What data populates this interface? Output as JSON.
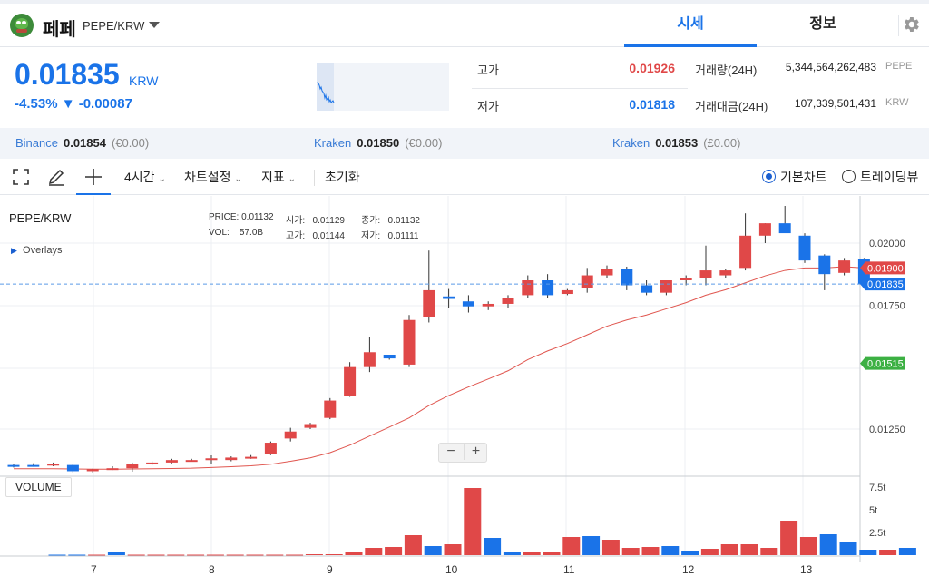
{
  "header": {
    "coin_name": "페페",
    "pair": "PEPE/KRW",
    "tabs": [
      {
        "label": "시세"
      },
      {
        "label": "정보"
      }
    ]
  },
  "summary": {
    "price": "0.01835",
    "price_unit": "KRW",
    "change": "-4.53% ▼ -0.00087",
    "high_label": "고가",
    "high_value": "0.01926",
    "low_label": "저가",
    "low_value": "0.01818",
    "volume_label": "거래량(24H)",
    "volume_value": "5,344,564,262,483",
    "volume_unit": "PEPE",
    "amount_label": "거래대금(24H)",
    "amount_value": "107,339,501,431",
    "amount_unit": "KRW"
  },
  "exchanges": [
    {
      "name": "Binance",
      "price": "0.01854",
      "krw": "(€0.00)"
    },
    {
      "name": "Kraken",
      "price": "0.01850",
      "krw": "(€0.00)"
    },
    {
      "name": "Kraken",
      "price": "0.01853",
      "krw": "(£0.00)"
    }
  ],
  "toolbar": {
    "interval": "4시간",
    "chart_settings": "차트설정",
    "indicators": "지표",
    "reset": "초기화",
    "basic_chart": "기본차트",
    "tradingview": "트레이딩뷰"
  },
  "chart": {
    "pair_title": "PEPE/KRW",
    "overlays": "Overlays",
    "legend": {
      "price_label": "PRICE:",
      "price": "0.01132",
      "open_label": "시가:",
      "open": "0.01129",
      "close_label": "종가:",
      "close": "0.01132",
      "vol_label": "VOL:",
      "vol": "57.0B",
      "high_label": "고가:",
      "high": "0.01144",
      "low_label": "저가:",
      "low": "0.01111"
    },
    "volume_tag": "VOLUME",
    "zoom_out": "−",
    "zoom_in": "+"
  },
  "chart_data": {
    "type": "candlestick",
    "price_axis_ticks": [
      "0.02000",
      "0.01750",
      "0.01250"
    ],
    "price_tags": [
      {
        "value": "0.01900",
        "color": "#e04848"
      },
      {
        "value": "0.01835",
        "color": "#1a73e8"
      },
      {
        "value": "0.01515",
        "color": "#3cb043"
      }
    ],
    "volume_axis_ticks": [
      "7.5t",
      "5t",
      "2.5t"
    ],
    "x_ticks": [
      "7",
      "8",
      "9",
      "10",
      "11",
      "12",
      "13"
    ],
    "up_color": "#e04848",
    "down_color": "#1a73e8",
    "candles": [
      {
        "o": 0.01105,
        "h": 0.0111,
        "l": 0.01095,
        "c": 0.011
      },
      {
        "o": 0.01105,
        "h": 0.01112,
        "l": 0.01098,
        "c": 0.011
      },
      {
        "o": 0.01105,
        "h": 0.01115,
        "l": 0.011,
        "c": 0.0111
      },
      {
        "o": 0.01105,
        "h": 0.01108,
        "l": 0.01075,
        "c": 0.0108
      },
      {
        "o": 0.0108,
        "h": 0.0109,
        "l": 0.01075,
        "c": 0.01088
      },
      {
        "o": 0.01088,
        "h": 0.011,
        "l": 0.01085,
        "c": 0.01092
      },
      {
        "o": 0.01092,
        "h": 0.01115,
        "l": 0.01078,
        "c": 0.01108
      },
      {
        "o": 0.01108,
        "h": 0.0112,
        "l": 0.01105,
        "c": 0.01115
      },
      {
        "o": 0.01115,
        "h": 0.0113,
        "l": 0.01112,
        "c": 0.01125
      },
      {
        "o": 0.01125,
        "h": 0.0113,
        "l": 0.0112,
        "c": 0.01125
      },
      {
        "o": 0.01129,
        "h": 0.01144,
        "l": 0.01111,
        "c": 0.01132
      },
      {
        "o": 0.01125,
        "h": 0.0114,
        "l": 0.0112,
        "c": 0.01135
      },
      {
        "o": 0.01135,
        "h": 0.01145,
        "l": 0.0113,
        "c": 0.01138
      },
      {
        "o": 0.01148,
        "h": 0.012,
        "l": 0.01145,
        "c": 0.01195
      },
      {
        "o": 0.01212,
        "h": 0.01255,
        "l": 0.012,
        "c": 0.0124
      },
      {
        "o": 0.01255,
        "h": 0.01275,
        "l": 0.0125,
        "c": 0.0127
      },
      {
        "o": 0.01295,
        "h": 0.01375,
        "l": 0.0129,
        "c": 0.01365
      },
      {
        "o": 0.01385,
        "h": 0.0152,
        "l": 0.0138,
        "c": 0.015
      },
      {
        "o": 0.015,
        "h": 0.0162,
        "l": 0.0148,
        "c": 0.0156
      },
      {
        "o": 0.0155,
        "h": 0.0155,
        "l": 0.0153,
        "c": 0.01535
      },
      {
        "o": 0.0151,
        "h": 0.0171,
        "l": 0.015,
        "c": 0.0169
      },
      {
        "o": 0.017,
        "h": 0.0197,
        "l": 0.0168,
        "c": 0.0181
      },
      {
        "o": 0.01785,
        "h": 0.01815,
        "l": 0.0174,
        "c": 0.01775
      },
      {
        "o": 0.01765,
        "h": 0.0179,
        "l": 0.0172,
        "c": 0.01745
      },
      {
        "o": 0.01745,
        "h": 0.01765,
        "l": 0.0173,
        "c": 0.01755
      },
      {
        "o": 0.01755,
        "h": 0.0179,
        "l": 0.0174,
        "c": 0.0178
      },
      {
        "o": 0.0179,
        "h": 0.0187,
        "l": 0.0178,
        "c": 0.0185
      },
      {
        "o": 0.0185,
        "h": 0.01875,
        "l": 0.0178,
        "c": 0.0179
      },
      {
        "o": 0.01795,
        "h": 0.01815,
        "l": 0.0179,
        "c": 0.0181
      },
      {
        "o": 0.0182,
        "h": 0.019,
        "l": 0.018,
        "c": 0.0187
      },
      {
        "o": 0.0187,
        "h": 0.0191,
        "l": 0.0186,
        "c": 0.01895
      },
      {
        "o": 0.01895,
        "h": 0.01905,
        "l": 0.0181,
        "c": 0.0183
      },
      {
        "o": 0.0183,
        "h": 0.0185,
        "l": 0.0179,
        "c": 0.018
      },
      {
        "o": 0.018,
        "h": 0.0185,
        "l": 0.0179,
        "c": 0.0185
      },
      {
        "o": 0.0185,
        "h": 0.0187,
        "l": 0.0183,
        "c": 0.0186
      },
      {
        "o": 0.0186,
        "h": 0.0199,
        "l": 0.0183,
        "c": 0.0189
      },
      {
        "o": 0.0187,
        "h": 0.01895,
        "l": 0.0186,
        "c": 0.0189
      },
      {
        "o": 0.019,
        "h": 0.0212,
        "l": 0.0189,
        "c": 0.0203
      },
      {
        "o": 0.0203,
        "h": 0.0208,
        "l": 0.02,
        "c": 0.0208
      },
      {
        "o": 0.0208,
        "h": 0.0215,
        "l": 0.0205,
        "c": 0.0204
      },
      {
        "o": 0.0203,
        "h": 0.0204,
        "l": 0.0192,
        "c": 0.0193
      },
      {
        "o": 0.0195,
        "h": 0.01955,
        "l": 0.0181,
        "c": 0.01875
      },
      {
        "o": 0.0188,
        "h": 0.0194,
        "l": 0.0187,
        "c": 0.0193
      },
      {
        "o": 0.01935,
        "h": 0.0194,
        "l": 0.0182,
        "c": 0.01835
      }
    ],
    "volumes": [
      0.05,
      0.05,
      0.05,
      0.3,
      0.05,
      0.05,
      0.05,
      0.05,
      0.05,
      0.05,
      0.05,
      0.05,
      0.05,
      0.1,
      0.1,
      0.4,
      0.8,
      0.9,
      2.2,
      1.0,
      1.2,
      7.4,
      1.9,
      0.3,
      0.3,
      0.3,
      2.0,
      2.1,
      1.7,
      0.8,
      0.9,
      1.0,
      0.5,
      0.7,
      1.2,
      1.2,
      0.8,
      3.8,
      2.0,
      2.3,
      1.5,
      0.6,
      0.6,
      0.8
    ],
    "ma": [
      0.0109,
      0.0109,
      0.0109,
      0.01089,
      0.01088,
      0.01088,
      0.01089,
      0.0109,
      0.01091,
      0.01092,
      0.01095,
      0.01098,
      0.01102,
      0.01108,
      0.0112,
      0.01134,
      0.01155,
      0.01185,
      0.01222,
      0.01258,
      0.01295,
      0.01345,
      0.01385,
      0.0142,
      0.01452,
      0.01485,
      0.0153,
      0.01565,
      0.01595,
      0.0163,
      0.01665,
      0.0169,
      0.0171,
      0.01735,
      0.0176,
      0.0179,
      0.01812,
      0.0184,
      0.01868,
      0.0189,
      0.019,
      0.019,
      0.01905,
      0.019
    ]
  }
}
